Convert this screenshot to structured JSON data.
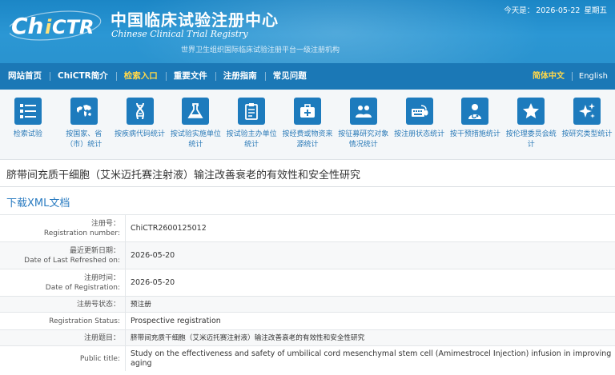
{
  "header": {
    "logo_text": "ChiCTR",
    "title_cn": "中国临床试验注册中心",
    "title_en": "Chinese Clinical Trial Registry",
    "subtitle": "世界卫生组织国际临床试验注册平台一级注册机构",
    "today_label": "今天是：",
    "today_date": "2026-05-22",
    "weekday": "星期五"
  },
  "nav": {
    "items": [
      {
        "label": "网站首页"
      },
      {
        "label": "ChiCTR简介"
      },
      {
        "label": "检索入口"
      },
      {
        "label": "重要文件"
      },
      {
        "label": "注册指南"
      },
      {
        "label": "常见问题"
      }
    ],
    "lang_cn": "简体中文",
    "lang_en": "English"
  },
  "icons": [
    {
      "label": "检索试验",
      "icon": "list-icon"
    },
    {
      "label": "按国家、省（市）统计",
      "icon": "world-map-icon"
    },
    {
      "label": "按疾病代码统计",
      "icon": "dna-icon"
    },
    {
      "label": "按试验实施单位统计",
      "icon": "flask-icon"
    },
    {
      "label": "按试验主办单位统计",
      "icon": "clipboard-icon"
    },
    {
      "label": "按经费或物资来源统计",
      "icon": "medkit-icon"
    },
    {
      "label": "按征募研究对象情况统计",
      "icon": "people-icon"
    },
    {
      "label": "按注册状态统计",
      "icon": "keyboard-icon"
    },
    {
      "label": "按干预措施统计",
      "icon": "doctor-icon"
    },
    {
      "label": "按伦理委员会统计",
      "icon": "star-icon"
    },
    {
      "label": "按研究类型统计",
      "icon": "sparkle-icon"
    }
  ],
  "page": {
    "title": "脐带间充质干细胞（艾米迈托赛注射液）输注改善衰老的有效性和安全性研究",
    "download": "下载XML文档"
  },
  "info": {
    "reg_no_cn": "注册号：",
    "reg_no_en": "Registration number:",
    "reg_no": "ChiCTR2600125012",
    "refresh_cn": "最近更新日期：",
    "refresh_en": "Date of Last Refreshed on:",
    "refresh_date": "2026-05-20",
    "reg_time_cn": "注册时间：",
    "reg_time_en": "Date of Registration:",
    "reg_date": "2026-05-20",
    "status_cn": "注册号状态：",
    "status_cn_val": "预注册",
    "status_en": "Registration Status:",
    "status_en_val": "Prospective registration",
    "title_cn_lbl": "注册题目：",
    "title_cn_val": "脐带间充质干细胞（艾米迈托赛注射液）输注改善衰老的有效性和安全性研究",
    "title_en_lbl": "Public title:",
    "title_en_val": "Study on the effectiveness and safety of umbilical cord mesenchymal stem cell (Amimestrocel Injection) infusion in improving aging"
  }
}
